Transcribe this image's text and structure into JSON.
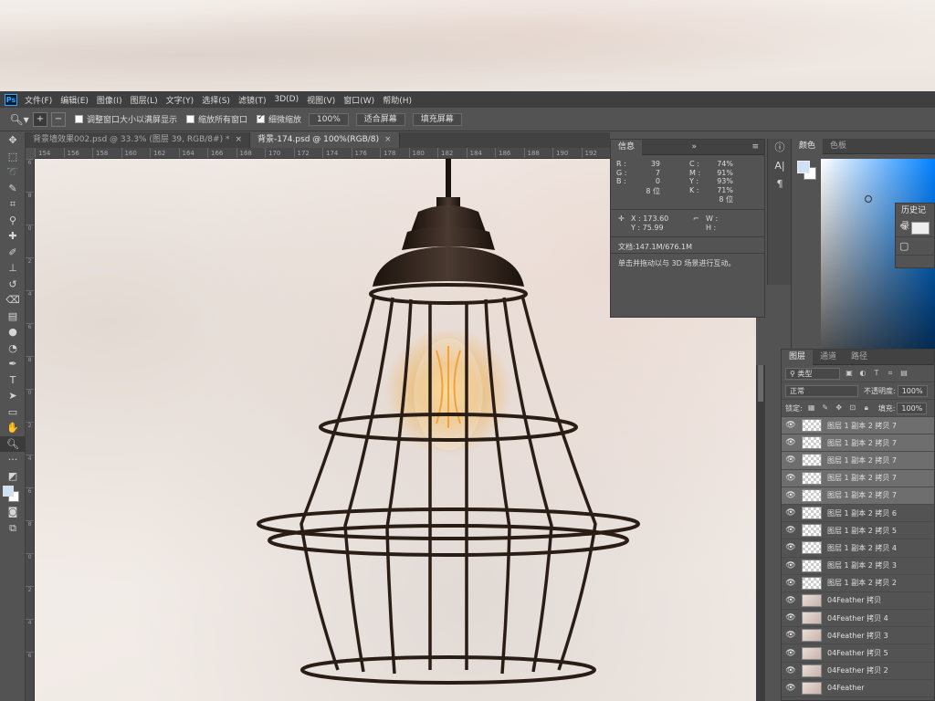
{
  "menubar": {
    "logo": "Ps",
    "items": [
      "文件(F)",
      "编辑(E)",
      "图像(I)",
      "图层(L)",
      "文字(Y)",
      "选择(S)",
      "滤镜(T)",
      "3D(D)",
      "视图(V)",
      "窗口(W)",
      "帮助(H)"
    ]
  },
  "options": {
    "resize_windows_label": "调整窗口大小以满屏显示",
    "zoom_all_label": "缩放所有窗口",
    "scrubby_zoom_label": "细微缩放",
    "zoom_value": "100%",
    "fit_screen_label": "适合屏幕",
    "fill_screen_label": "填充屏幕"
  },
  "tabs": [
    {
      "label": "背景墙效果002.psd @ 33.3% (图层 39, RGB/8#) *",
      "active": false
    },
    {
      "label": "背景-174.psd @ 100%(RGB/8)",
      "active": true
    }
  ],
  "ruler": {
    "top": [
      "154",
      "156",
      "158",
      "160",
      "162",
      "164",
      "166",
      "168",
      "170",
      "172",
      "174",
      "176",
      "178",
      "180",
      "182",
      "184",
      "186",
      "188",
      "190",
      "192"
    ],
    "left": [
      "6",
      "8",
      "0",
      "2",
      "4",
      "6",
      "8",
      "0",
      "2",
      "4",
      "6",
      "8",
      "0",
      "2",
      "4",
      "6"
    ]
  },
  "info": {
    "tab_info": "信息",
    "tab_menu": "»",
    "rgb": [
      {
        "k": "R :",
        "v": "39"
      },
      {
        "k": "G :",
        "v": "7"
      },
      {
        "k": "B :",
        "v": "0"
      }
    ],
    "cmyk": [
      {
        "k": "C :",
        "v": "74%"
      },
      {
        "k": "M :",
        "v": "91%"
      },
      {
        "k": "Y :",
        "v": "93%"
      },
      {
        "k": "K :",
        "v": "71%"
      }
    ],
    "bits_left": "8 位",
    "bits_right": "8 位",
    "x": "173.60",
    "y": "75.99",
    "w": "W :",
    "h": "H :",
    "doc": "文档:147.1M/676.1M",
    "hint": "单击并拖动以与 3D 场景进行互动。"
  },
  "color_panel": {
    "tab_color": "颜色",
    "tab_swatches": "色板",
    "fg_color": "#cfe2f5",
    "bg_color": "#ffffff"
  },
  "history": {
    "tab": "历史记录"
  },
  "layers": {
    "tab_layers": "图层",
    "tab_channels": "通道",
    "tab_paths": "路径",
    "filter_kind": "类型",
    "blend_mode": "正常",
    "opacity_label": "不透明度:",
    "opacity_value": "100%",
    "lock_label": "锁定:",
    "fill_label": "填充:",
    "fill_value": "100%",
    "items": [
      {
        "name": "图层 1 副本 2 拷贝 7",
        "selected": true,
        "smart": false
      },
      {
        "name": "图层 1 副本 2 拷贝 7",
        "selected": true,
        "smart": false
      },
      {
        "name": "图层 1 副本 2 拷贝 7",
        "selected": true,
        "smart": false
      },
      {
        "name": "图层 1 副本 2 拷贝 7",
        "selected": true,
        "smart": false
      },
      {
        "name": "图层 1 副本 2 拷贝 7",
        "selected": true,
        "smart": false
      },
      {
        "name": "图层 1 副本 2 拷贝 6",
        "selected": false,
        "smart": false
      },
      {
        "name": "图层 1 副本 2 拷贝 5",
        "selected": false,
        "smart": false
      },
      {
        "name": "图层 1 副本 2 拷贝 4",
        "selected": false,
        "smart": false
      },
      {
        "name": "图层 1 副本 2 拷贝 3",
        "selected": false,
        "smart": false
      },
      {
        "name": "图层 1 副本 2 拷贝 2",
        "selected": false,
        "smart": false
      },
      {
        "name": "04Feather 拷贝",
        "selected": false,
        "smart": true
      },
      {
        "name": "04Feather 拷贝 4",
        "selected": false,
        "smart": true
      },
      {
        "name": "04Feather 拷贝 3",
        "selected": false,
        "smart": true
      },
      {
        "name": "04Feather 拷贝 5",
        "selected": false,
        "smart": true
      },
      {
        "name": "04Feather 拷贝 2",
        "selected": false,
        "smart": true
      },
      {
        "name": "04Feather",
        "selected": false,
        "smart": true
      }
    ]
  }
}
